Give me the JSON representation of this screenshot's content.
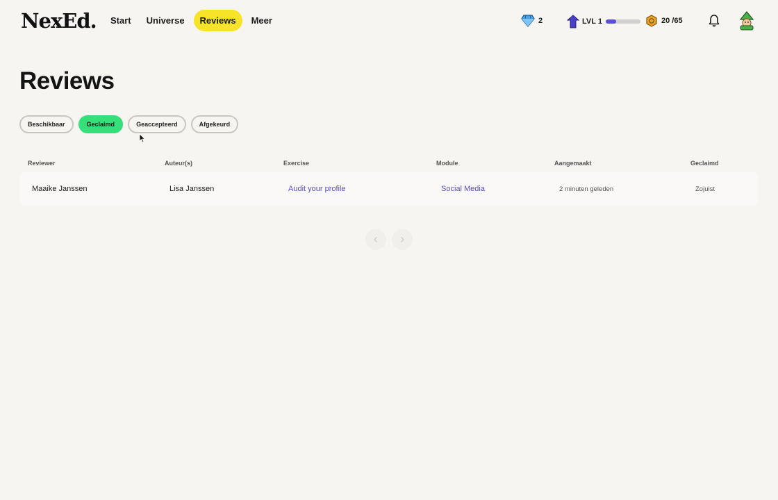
{
  "brand": {
    "logo": "NexEd",
    "logo_dot": "."
  },
  "nav": {
    "items": [
      {
        "label": "Start"
      },
      {
        "label": "Universe"
      },
      {
        "label": "Reviews",
        "active": true
      },
      {
        "label": "Meer"
      }
    ]
  },
  "stats": {
    "gems": "2",
    "level": "LVL 1",
    "level_progress": 0.3,
    "coins": "20 /65"
  },
  "page": {
    "title": "Reviews"
  },
  "filters": [
    {
      "label": "Beschikbaar"
    },
    {
      "label": "Geclaimd",
      "active": true
    },
    {
      "label": "Geaccepteerd"
    },
    {
      "label": "Afgekeurd"
    }
  ],
  "table": {
    "headers": [
      "Reviewer",
      "Auteur(s)",
      "Exercise",
      "Module",
      "Aangemaakt",
      "Geclaimd"
    ],
    "rows": [
      {
        "reviewer": "Maaike Janssen",
        "authors": "Lisa Janssen",
        "exercise": "Audit your profile",
        "module": "Social Media",
        "created": "2 minuten geleden",
        "claimed": "Zojuist"
      }
    ]
  },
  "pagination": {
    "prev_icon": "chevron-left-icon",
    "next_icon": "chevron-right-icon"
  },
  "colors": {
    "accent_nav": "#f7e327",
    "accent_filter": "#35e07a",
    "link": "#5650cc",
    "progress": "#5a4fd8"
  }
}
